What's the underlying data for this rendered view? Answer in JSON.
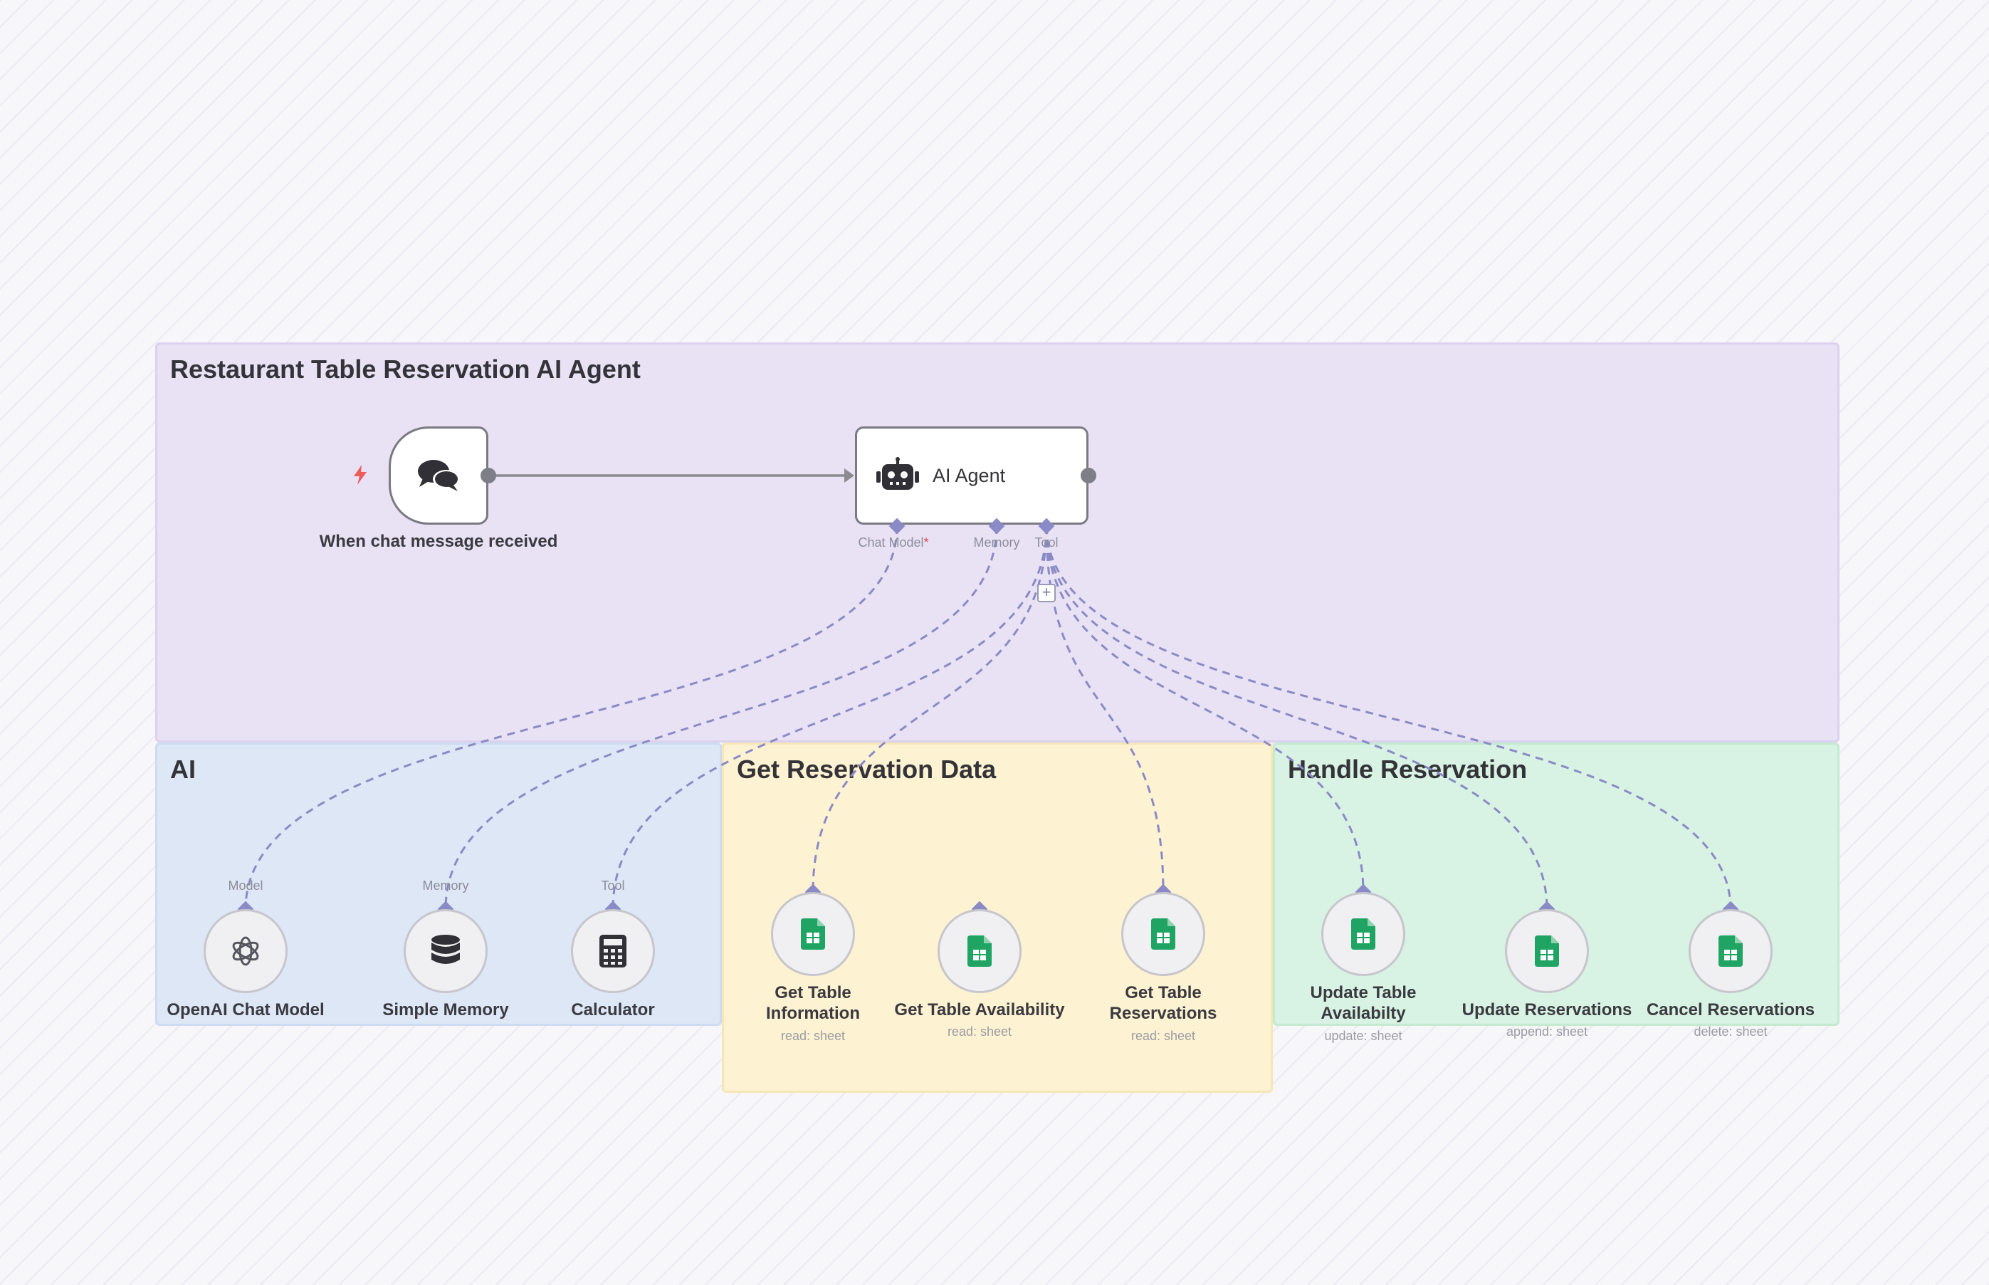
{
  "canvas": {
    "stickies": {
      "main": "Restaurant Table Reservation AI Agent",
      "ai": "AI",
      "data": "Get Reservation Data",
      "handle": "Handle Reservation"
    },
    "trigger": {
      "name": "When chat message received",
      "icon": "chat-bubbles-icon"
    },
    "agent": {
      "name": "AI Agent",
      "icon": "robot-icon",
      "ports": {
        "chat_model": "Chat Model",
        "chat_model_required": "*",
        "memory": "Memory",
        "tool": "Tool"
      }
    },
    "ai_nodes": [
      {
        "name": "OpenAI Chat Model",
        "port": "Model",
        "icon": "openai-icon"
      },
      {
        "name": "Simple Memory",
        "port": "Memory",
        "icon": "database-icon"
      },
      {
        "name": "Calculator",
        "port": "Tool",
        "icon": "calculator-icon"
      }
    ],
    "data_nodes": [
      {
        "name": "Get Table Information",
        "sub": "read: sheet",
        "icon": "google-sheets-icon"
      },
      {
        "name": "Get Table Availability",
        "sub": "read: sheet",
        "icon": "google-sheets-icon"
      },
      {
        "name": "Get Table Reservations",
        "sub": "read: sheet",
        "icon": "google-sheets-icon"
      }
    ],
    "handle_nodes": [
      {
        "name": "Update Table Availabilty",
        "sub": "update: sheet",
        "icon": "google-sheets-icon"
      },
      {
        "name": "Update Reservations",
        "sub": "append: sheet",
        "icon": "google-sheets-icon"
      },
      {
        "name": "Cancel Reservations",
        "sub": "delete: sheet",
        "icon": "google-sheets-icon"
      }
    ],
    "colors": {
      "main_sticky": "#e8e2f4",
      "ai_sticky": "#dde7f6",
      "data_sticky": "#fdf2d2",
      "handle_sticky": "#d8f2e3",
      "connector": "#8a8ac7",
      "sheets_green": "#20a464",
      "trigger_bolt": "#ee5b5b"
    }
  }
}
